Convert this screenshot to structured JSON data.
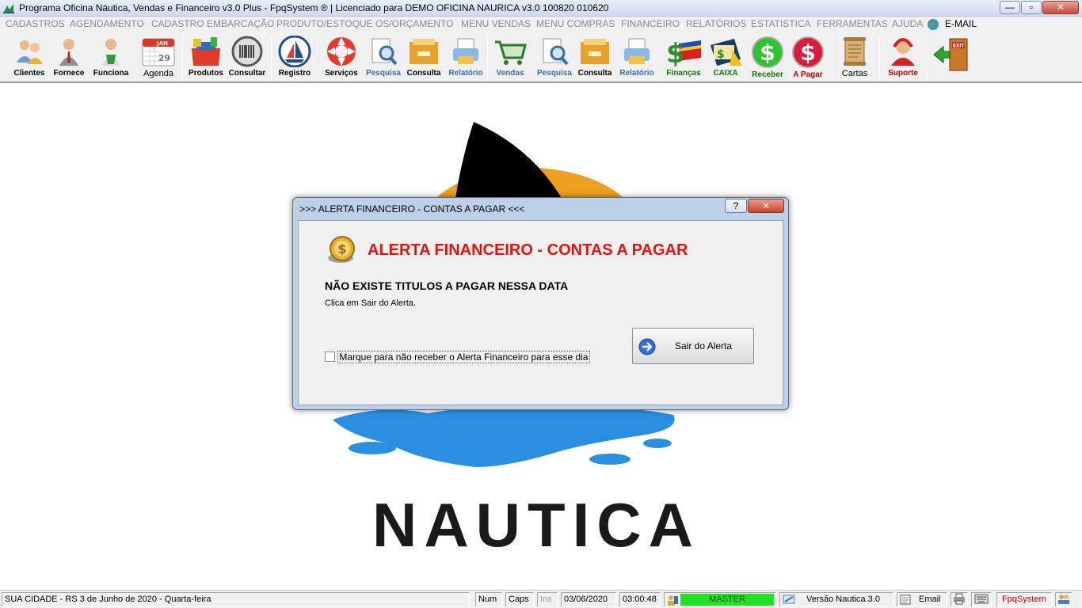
{
  "window": {
    "title": "Programa Oficina Náutica, Vendas e Financeiro v3.0 Plus - FpqSystem ® | Licenciado para  DEMO OFICINA NAURICA v3.0 100820 010620",
    "minimize": "—",
    "maximize": "▫",
    "close": "✕"
  },
  "menu": [
    "CADASTROS",
    "AGENDAMENTO",
    "CADASTRO EMBARCAÇÃO",
    "PRODUTO/ESTOQUE",
    "OS/ORÇAMENTO",
    "MENU VENDAS",
    "MENU COMPRAS",
    "FINANCEIRO",
    "RELATÓRIOS",
    "ESTATISTICA",
    "FERRAMENTAS",
    "AJUDA"
  ],
  "menu_email": "E-MAIL",
  "toolbar": {
    "clientes": "Clientes",
    "fornece": "Fornece",
    "funciona": "Funciona",
    "agenda": "Agenda",
    "agenda_month": "JAN",
    "agenda_day": "29",
    "produtos": "Produtos",
    "consultar": "Consultar",
    "registro": "Registro",
    "servicos": "Serviços",
    "pesquisa1": "Pesquisa",
    "consulta1": "Consulta",
    "relatorio1": "Relatório",
    "vendas": "Vendas",
    "pesquisa2": "Pesquisa",
    "consulta2": "Consulta",
    "relatorio2": "Relatório",
    "financas": "Finanças",
    "caixa": "CAIXA",
    "receber": "Receber",
    "apagar": "A Pagar",
    "cartas": "Cartas",
    "suporte": "Suporte",
    "exit": "EXIT"
  },
  "background": {
    "logo_text": "NAUTICA"
  },
  "dialog": {
    "title": ">>> ALERTA FINANCEIRO - CONTAS A PAGAR <<<",
    "help": "?",
    "close": "✕",
    "heading": "ALERTA FINANCEIRO - CONTAS A PAGAR",
    "message": "NÃO EXISTE TITULOS A PAGAR NESSA DATA",
    "hint": "Clica em Sair do Alerta.",
    "checkbox_label": "Marque para não receber o Alerta Financeiro para esse dia",
    "checkbox_checked": false,
    "exit_button": "Sair do Alerta"
  },
  "status": {
    "location": "SUA CIDADE - RS  3 de Junho de 2020 - Quarta-feira",
    "num": "Num",
    "caps": "Caps",
    "ins": "Ins",
    "date": "03/06/2020",
    "time": "03:00:48",
    "user": "MASTER",
    "version": "Versão Nautica 3.0",
    "email": "Email",
    "brand": "FpqSystem"
  },
  "colors": {
    "alert_red": "#e8120c",
    "master_green": "#22e022",
    "logo_blue": "#2b8fe0",
    "logo_orange": "#f0a020"
  }
}
